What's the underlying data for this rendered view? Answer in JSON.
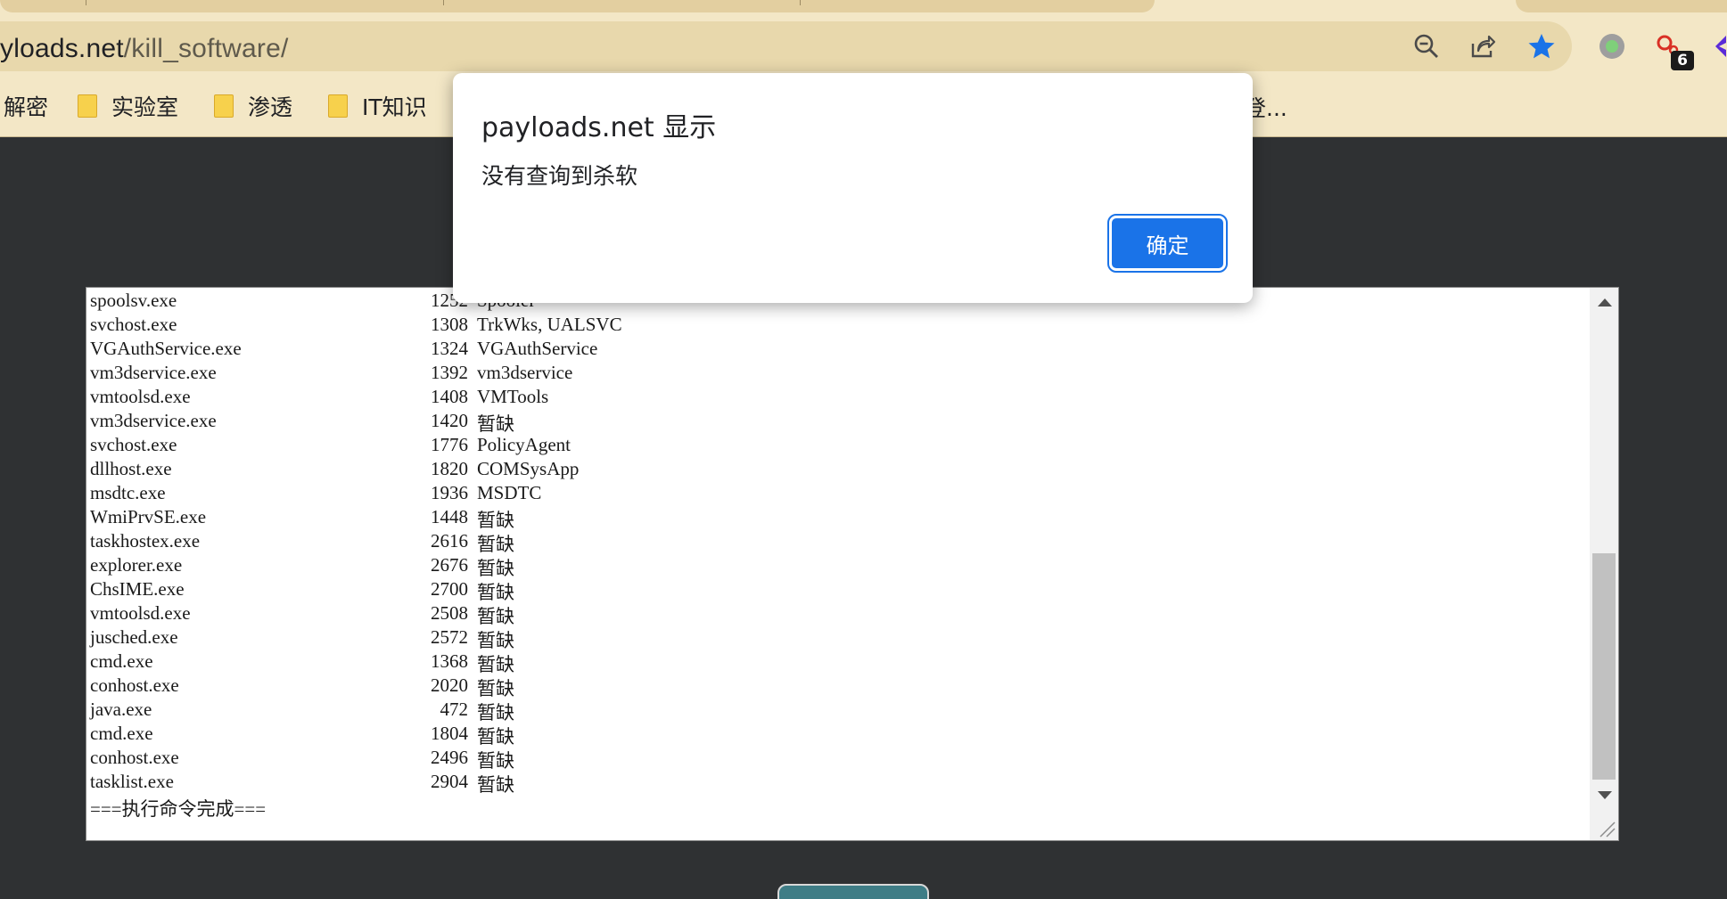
{
  "browser": {
    "url_prefix": "yloads.net",
    "url_path": "/kill_software/",
    "extension_badge": "6",
    "colors": {
      "chrome": "#f3e7c6",
      "omnibox": "#e8d8ac",
      "star": "#1a73e8"
    }
  },
  "bookmarks": [
    {
      "label": "解密"
    },
    {
      "label": "实验室"
    },
    {
      "label": "渗透"
    },
    {
      "label": "IT知识"
    }
  ],
  "bookmark_overflow": "登...",
  "dialog": {
    "title": "payloads.net 显示",
    "message": "没有查询到杀软",
    "ok_label": "确定"
  },
  "output": {
    "rows": [
      {
        "name": "spoolsv.exe",
        "pid": "1252",
        "service": "Spooler"
      },
      {
        "name": "svchost.exe",
        "pid": "1308",
        "service": "TrkWks, UALSVC"
      },
      {
        "name": "VGAuthService.exe",
        "pid": "1324",
        "service": "VGAuthService"
      },
      {
        "name": "vm3dservice.exe",
        "pid": "1392",
        "service": "vm3dservice"
      },
      {
        "name": "vmtoolsd.exe",
        "pid": "1408",
        "service": "VMTools"
      },
      {
        "name": "vm3dservice.exe",
        "pid": "1420",
        "service": "暂缺"
      },
      {
        "name": "svchost.exe",
        "pid": "1776",
        "service": "PolicyAgent"
      },
      {
        "name": "dllhost.exe",
        "pid": "1820",
        "service": "COMSysApp"
      },
      {
        "name": "msdtc.exe",
        "pid": "1936",
        "service": "MSDTC"
      },
      {
        "name": "WmiPrvSE.exe",
        "pid": "1448",
        "service": "暂缺"
      },
      {
        "name": "taskhostex.exe",
        "pid": "2616",
        "service": "暂缺"
      },
      {
        "name": "explorer.exe",
        "pid": "2676",
        "service": "暂缺"
      },
      {
        "name": "ChsIME.exe",
        "pid": "2700",
        "service": "暂缺"
      },
      {
        "name": "vmtoolsd.exe",
        "pid": "2508",
        "service": "暂缺"
      },
      {
        "name": "jusched.exe",
        "pid": "2572",
        "service": "暂缺"
      },
      {
        "name": "cmd.exe",
        "pid": "1368",
        "service": "暂缺"
      },
      {
        "name": "conhost.exe",
        "pid": "2020",
        "service": "暂缺"
      },
      {
        "name": "java.exe",
        "pid": "472",
        "service": "暂缺"
      },
      {
        "name": "cmd.exe",
        "pid": "1804",
        "service": "暂缺"
      },
      {
        "name": "conhost.exe",
        "pid": "2496",
        "service": "暂缺"
      },
      {
        "name": "tasklist.exe",
        "pid": "2904",
        "service": "暂缺"
      }
    ],
    "footer": "===执行命令完成==="
  }
}
